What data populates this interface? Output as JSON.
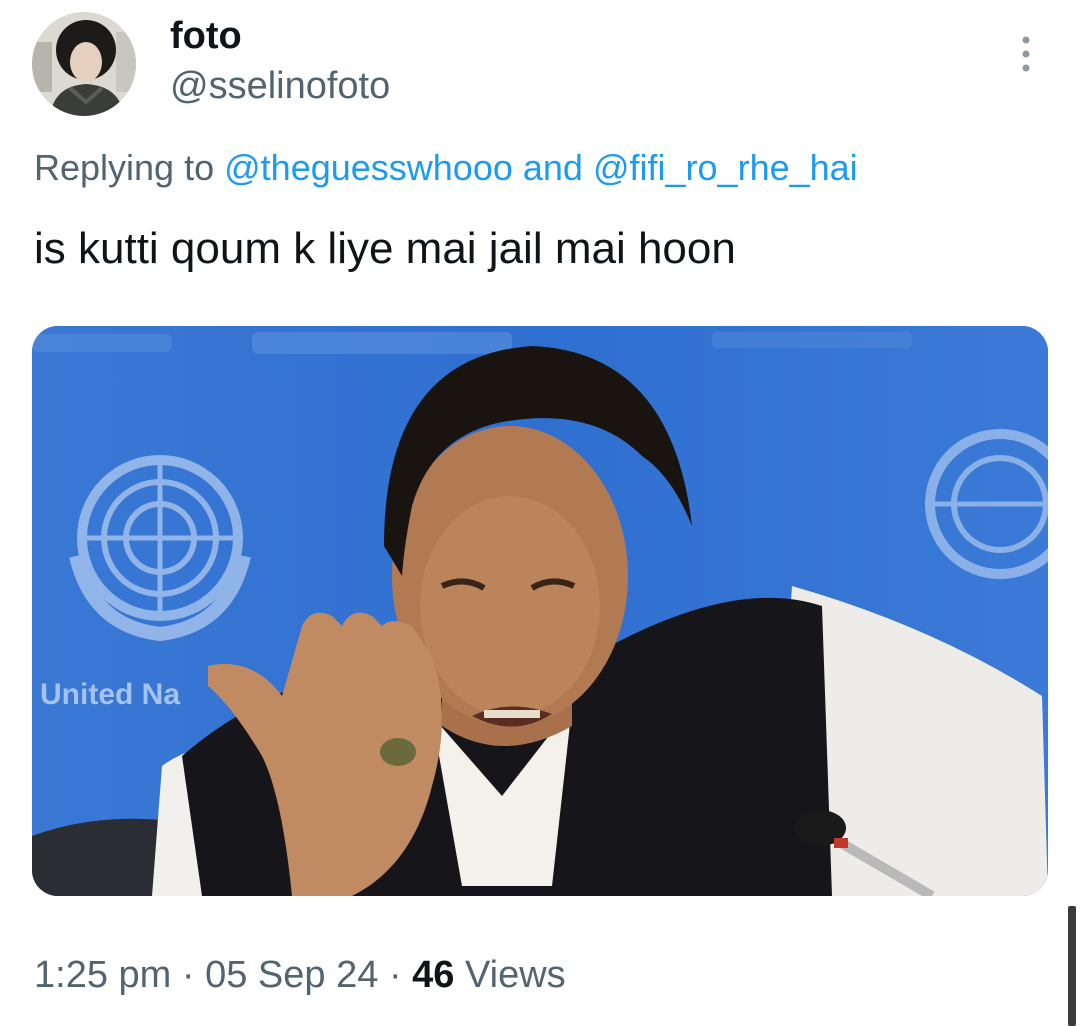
{
  "author": {
    "display_name": "foto",
    "handle": "@sselinofoto"
  },
  "reply": {
    "prefix": "Replying to",
    "user1": "@theguesswhooo",
    "connector": "and",
    "user2": "@fifi_ro_rhe_hai"
  },
  "tweet": {
    "text": "is kutti qoum k liye mai jail mai hoon"
  },
  "media": {
    "background_text": "United Na"
  },
  "meta": {
    "time": "1:25 pm",
    "separator": "·",
    "date": "05 Sep 24",
    "views_count": "46",
    "views_label": "Views"
  },
  "icons": {
    "more": "more-vertical-icon",
    "emblem": "un-emblem-icon"
  },
  "colors": {
    "link": "#1d9bf0",
    "secondary_text": "#536471",
    "primary_text": "#0f1419",
    "media_background": "#2f6fd0"
  }
}
